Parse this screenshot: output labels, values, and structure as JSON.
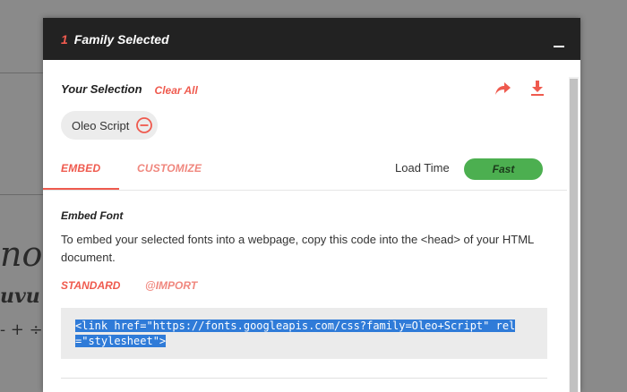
{
  "background": {
    "glyph_row_1": "nor",
    "glyph_row_2": "uvu",
    "glyph_row_3": "- + ÷"
  },
  "header": {
    "count": "1",
    "title": "Family Selected"
  },
  "selection": {
    "title": "Your Selection",
    "clear_all": "Clear All",
    "fonts": [
      "Oleo Script"
    ]
  },
  "tabs": {
    "embed": "EMBED",
    "customize": "CUSTOMIZE",
    "active": "EMBED"
  },
  "load_time": {
    "label": "Load Time",
    "value": "Fast"
  },
  "embed": {
    "title": "Embed Font",
    "description": "To embed your selected fonts into a webpage, copy this code into the <head> of your HTML document.",
    "subtabs": {
      "standard": "STANDARD",
      "import": "@IMPORT",
      "active": "STANDARD"
    },
    "code_line_1": "<link href=\"https://fonts.googleapis.com/css?family=Oleo+Script\" rel",
    "code_line_2": "=\"stylesheet\">"
  },
  "colors": {
    "accent": "#ef5a4e",
    "header_bg": "#222222",
    "fast_badge": "#4caf50",
    "code_selection": "#2f7bd8"
  },
  "icons": {
    "share": "share-arrow-icon",
    "download": "download-icon",
    "remove": "remove-circle-icon",
    "minimize": "minimize-icon"
  }
}
